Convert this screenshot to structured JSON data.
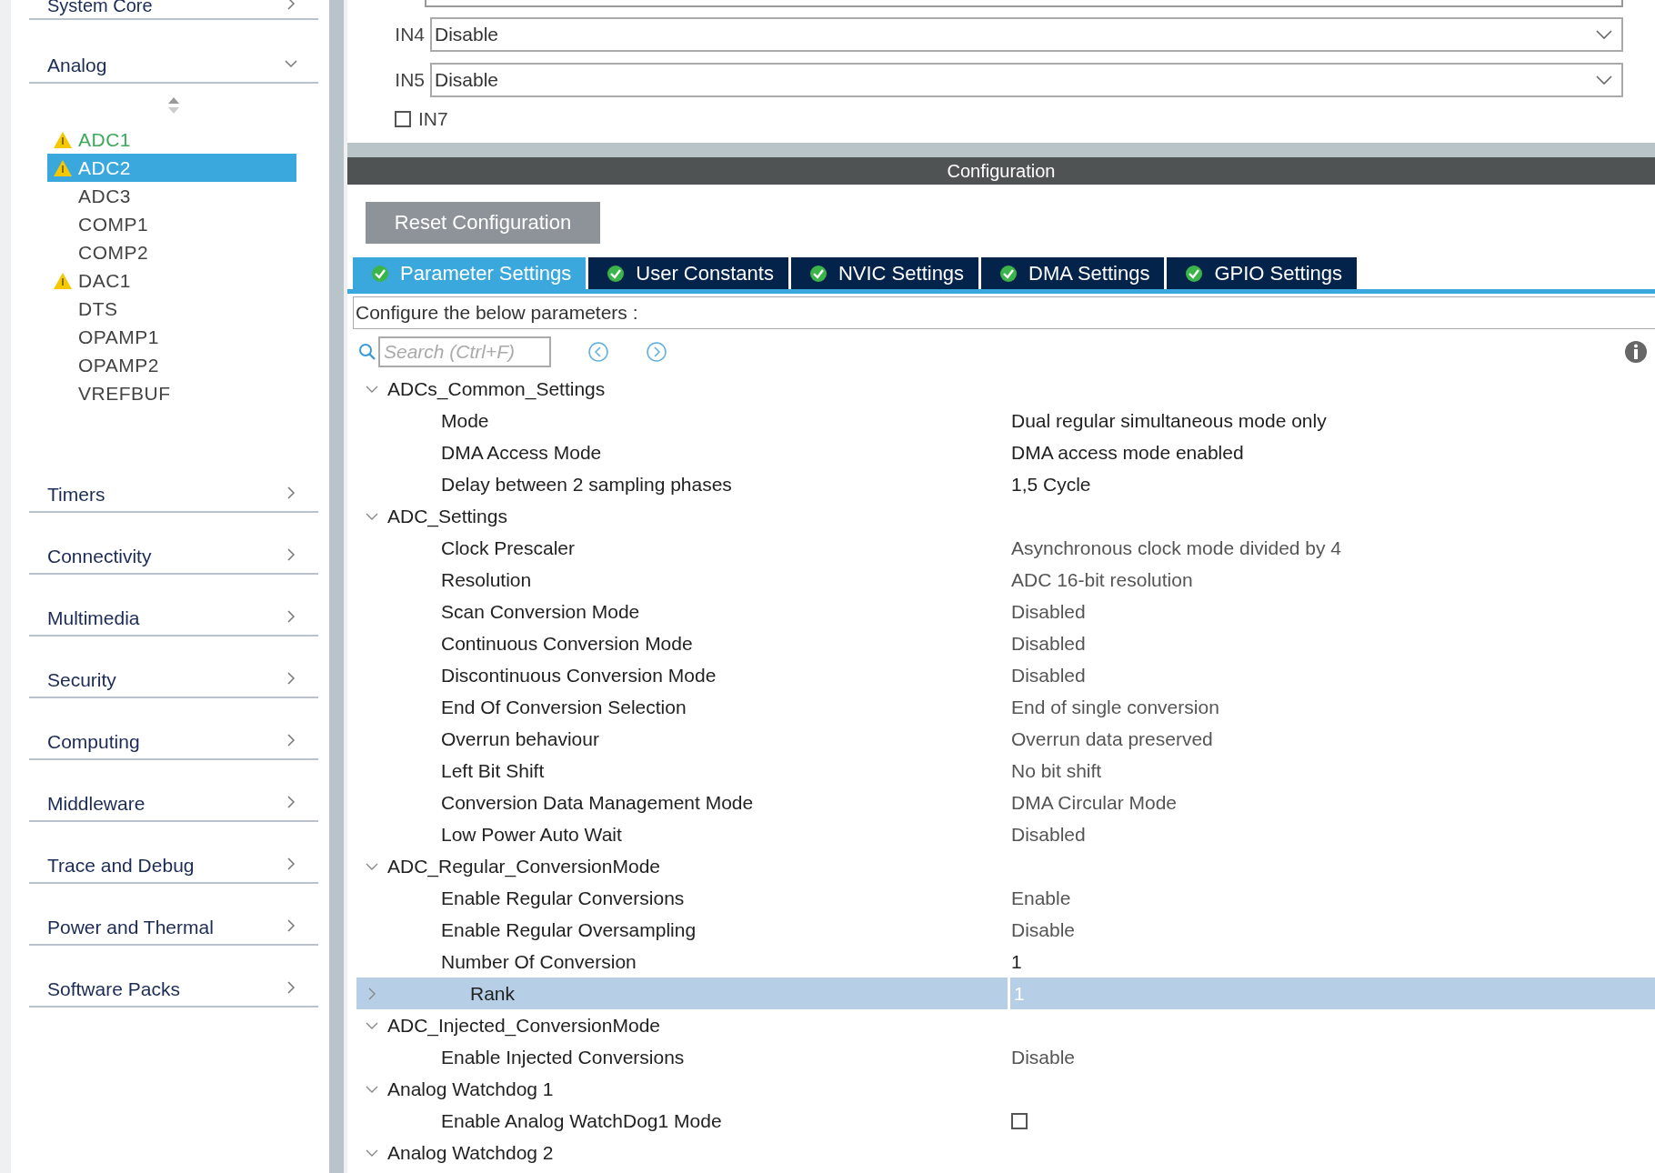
{
  "sidebar": {
    "categories": [
      {
        "label": "System Core",
        "expanded": false
      },
      {
        "label": "Analog",
        "expanded": true,
        "items": [
          {
            "label": "ADC1",
            "warning": true,
            "configured": true,
            "selected": false
          },
          {
            "label": "ADC2",
            "warning": true,
            "configured": false,
            "selected": true
          },
          {
            "label": "ADC3",
            "warning": false,
            "configured": false,
            "selected": false
          },
          {
            "label": "COMP1",
            "warning": false,
            "configured": false,
            "selected": false
          },
          {
            "label": "COMP2",
            "warning": false,
            "configured": false,
            "selected": false
          },
          {
            "label": "DAC1",
            "warning": true,
            "configured": false,
            "selected": false
          },
          {
            "label": "DTS",
            "warning": false,
            "configured": false,
            "selected": false
          },
          {
            "label": "OPAMP1",
            "warning": false,
            "configured": false,
            "selected": false
          },
          {
            "label": "OPAMP2",
            "warning": false,
            "configured": false,
            "selected": false
          },
          {
            "label": "VREFBUF",
            "warning": false,
            "configured": false,
            "selected": false
          }
        ]
      },
      {
        "label": "Timers",
        "expanded": false
      },
      {
        "label": "Connectivity",
        "expanded": false
      },
      {
        "label": "Multimedia",
        "expanded": false
      },
      {
        "label": "Security",
        "expanded": false
      },
      {
        "label": "Computing",
        "expanded": false
      },
      {
        "label": "Middleware",
        "expanded": false
      },
      {
        "label": "Trace and Debug",
        "expanded": false
      },
      {
        "label": "Power and Thermal",
        "expanded": false
      },
      {
        "label": "Software Packs",
        "expanded": false
      }
    ]
  },
  "inputs": [
    {
      "kind": "dropdown",
      "label": "IN4",
      "value": "Disable"
    },
    {
      "kind": "dropdown",
      "label": "IN5",
      "value": "Disable"
    },
    {
      "kind": "checkbox",
      "label": "IN7",
      "checked": false
    }
  ],
  "configuration": {
    "title": "Configuration",
    "reset_button": "Reset Configuration",
    "tabs": [
      {
        "label": "Parameter Settings",
        "selected": true
      },
      {
        "label": "User Constants",
        "selected": false
      },
      {
        "label": "NVIC Settings",
        "selected": false
      },
      {
        "label": "DMA Settings",
        "selected": false
      },
      {
        "label": "GPIO Settings",
        "selected": false
      }
    ],
    "hint": "Configure the below parameters :",
    "search": {
      "placeholder": "Search (Ctrl+F)"
    },
    "tree": [
      {
        "label": "ADCs_Common_Settings",
        "expanded": true,
        "children": [
          {
            "label": "Mode",
            "value": "Dual regular simultaneous mode only",
            "dimmed": false
          },
          {
            "label": "DMA Access Mode",
            "value": "DMA access mode enabled",
            "dimmed": false
          },
          {
            "label": "Delay between 2 sampling phases",
            "value": "1,5 Cycle",
            "dimmed": false
          }
        ]
      },
      {
        "label": "ADC_Settings",
        "expanded": true,
        "children": [
          {
            "label": "Clock Prescaler",
            "value": "Asynchronous clock mode divided by 4",
            "dimmed": true
          },
          {
            "label": "Resolution",
            "value": "ADC 16-bit resolution",
            "dimmed": true
          },
          {
            "label": "Scan Conversion Mode",
            "value": "Disabled",
            "dimmed": true
          },
          {
            "label": "Continuous Conversion Mode",
            "value": "Disabled",
            "dimmed": true
          },
          {
            "label": "Discontinuous Conversion Mode",
            "value": "Disabled",
            "dimmed": true
          },
          {
            "label": "End Of Conversion Selection",
            "value": "End of single conversion",
            "dimmed": true
          },
          {
            "label": "Overrun behaviour",
            "value": "Overrun data preserved",
            "dimmed": true
          },
          {
            "label": "Left Bit Shift",
            "value": "No bit shift",
            "dimmed": true
          },
          {
            "label": "Conversion Data Management Mode",
            "value": "DMA Circular Mode",
            "dimmed": true
          },
          {
            "label": "Low Power Auto Wait",
            "value": "Disabled",
            "dimmed": true
          }
        ]
      },
      {
        "label": "ADC_Regular_ConversionMode",
        "expanded": true,
        "children": [
          {
            "label": "Enable Regular Conversions",
            "value": "Enable",
            "dimmed": true
          },
          {
            "label": "Enable Regular Oversampling",
            "value": "Disable",
            "dimmed": true
          },
          {
            "label": "Number Of Conversion",
            "value": "1",
            "dimmed": false
          },
          {
            "label": "Rank",
            "value": "1",
            "dimmed": false,
            "expanded": false,
            "selected": true
          }
        ]
      },
      {
        "label": "ADC_Injected_ConversionMode",
        "expanded": true,
        "children": [
          {
            "label": "Enable Injected Conversions",
            "value": "Disable",
            "dimmed": true
          }
        ]
      },
      {
        "label": "Analog Watchdog 1",
        "expanded": true,
        "children": [
          {
            "label": "Enable Analog WatchDog1 Mode",
            "kind": "checkbox",
            "checked": false
          }
        ]
      },
      {
        "label": "Analog Watchdog 2",
        "expanded": true
      }
    ]
  }
}
